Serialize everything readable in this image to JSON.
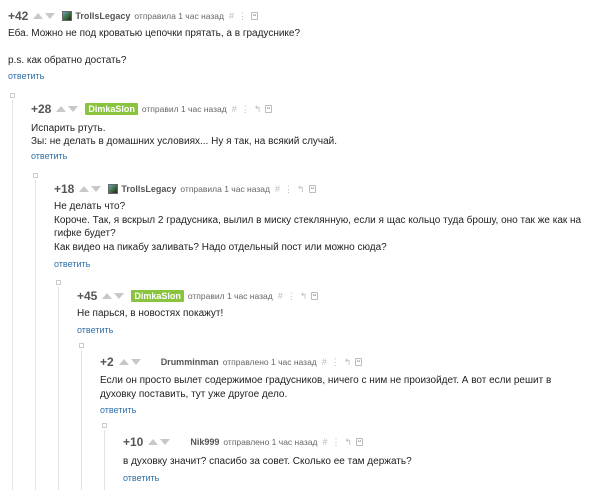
{
  "reply_label": "ответить",
  "colors": {
    "link": "#2e6fa8",
    "badge": "#8ac43f",
    "meta": "#666666"
  },
  "comments": [
    {
      "rating": "+42",
      "author": "TrollsLegacy",
      "meta": "отправила 1 час назад",
      "lines": [
        "Еба. Можно не под кроватью цепочки прятать, а в градуснике?",
        "",
        "p.s. как обратно достать?"
      ]
    },
    {
      "rating": "+28",
      "author": "DimkaSlon",
      "meta": "отправил 1 час назад",
      "lines": [
        "Испарить ртуть.",
        "Зы: не делать в домашних условиях... Ну я так, на всякий случай."
      ]
    },
    {
      "rating": "+18",
      "author": "TrollsLegacy",
      "meta": "отправила 1 час назад",
      "lines": [
        "Не делать что?",
        "Короче. Так, я вскрыл 2 градусника, вылил в миску стеклянную, если я щас кольцо туда брошу, оно так же как на",
        "гифке будет?",
        "Как видео на пикабу заливать? Надо отдельный пост или можно сюда?"
      ]
    },
    {
      "rating": "+45",
      "author": "DimkaSlon",
      "meta": "отправил 1 час назад",
      "lines": [
        "Не парься, в новостях покажут!"
      ]
    },
    {
      "rating": "+2",
      "author": "Drumminman",
      "meta": "отправлено 1 час назад",
      "lines": [
        "Если он просто вылет содержимое градусников, ничего с ним не произойдет. А вот если решит  в",
        "духовку поставить, тут уже другое дело."
      ]
    },
    {
      "rating": "+10",
      "author": "Nik999",
      "meta": "отправлено 1 час назад",
      "lines": [
        "в духовку значит? спасибо за совет. Сколько ее там держать?"
      ]
    }
  ]
}
